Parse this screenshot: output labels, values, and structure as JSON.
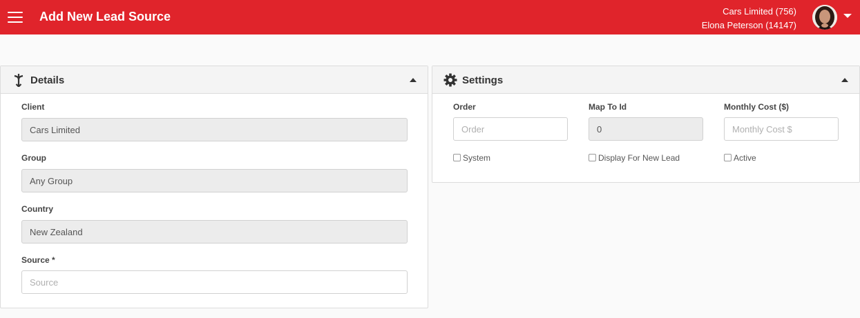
{
  "header": {
    "title": "Add New Lead Source",
    "company": "Cars Limited (756)",
    "user": "Elona Peterson (14147)",
    "menu_icon": "hamburger-menu-icon",
    "user_dropdown_icon": "caret-down-icon",
    "accent_color": "#e0242b"
  },
  "details": {
    "title": "Details",
    "icon": "merge-arrow-icon",
    "fields": {
      "client": {
        "label": "Client",
        "value": "Cars Limited"
      },
      "group": {
        "label": "Group",
        "value": "Any Group"
      },
      "country": {
        "label": "Country",
        "value": "New Zealand"
      },
      "source": {
        "label": "Source *",
        "value": "",
        "placeholder": "Source"
      }
    }
  },
  "settings": {
    "title": "Settings",
    "icon": "gear-icon",
    "fields": {
      "order": {
        "label": "Order",
        "value": "",
        "placeholder": "Order"
      },
      "map_to_id": {
        "label": "Map To Id",
        "value": "0"
      },
      "monthly_cost": {
        "label": "Monthly Cost ($)",
        "value": "",
        "placeholder": "Monthly Cost $"
      }
    },
    "checkboxes": {
      "system": {
        "label": "System",
        "checked": false
      },
      "display_for_new_lead": {
        "label": "Display For New Lead",
        "checked": false
      },
      "active": {
        "label": "Active",
        "checked": false
      }
    }
  }
}
